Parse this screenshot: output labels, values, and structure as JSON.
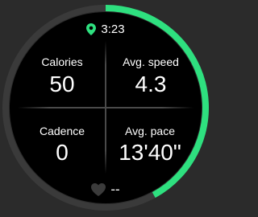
{
  "status": {
    "time": "3:23",
    "location_icon": "location-pin-icon"
  },
  "progress": {
    "fraction": 0.42,
    "color": "#2ee07f",
    "track_color": "#3a3a3a"
  },
  "metrics": [
    {
      "label": "Calories",
      "value": "50"
    },
    {
      "label": "Avg. speed",
      "value": "4.3"
    },
    {
      "label": "Cadence",
      "value": "0"
    },
    {
      "label": "Avg. pace",
      "value": "13'40\""
    }
  ],
  "heart_rate": {
    "icon": "heart-icon",
    "value": "--"
  }
}
